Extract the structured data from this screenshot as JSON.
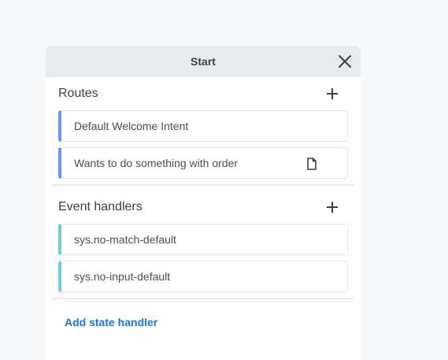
{
  "panel": {
    "title": "Start"
  },
  "routes": {
    "title": "Routes",
    "items": [
      {
        "label": "Default Welcome Intent"
      },
      {
        "label": "Wants to do something with order"
      }
    ]
  },
  "event_handlers": {
    "title": "Event handlers",
    "items": [
      {
        "label": "sys.no-match-default"
      },
      {
        "label": "sys.no-input-default"
      }
    ]
  },
  "footer": {
    "add_state_handler_label": "Add state handler"
  },
  "icons": {
    "close": "close-icon",
    "add": "plus-icon",
    "document": "document-icon"
  },
  "colors": {
    "route_accent": "#6b96e8",
    "event_accent": "#72cde3",
    "link": "#1a73e8"
  }
}
